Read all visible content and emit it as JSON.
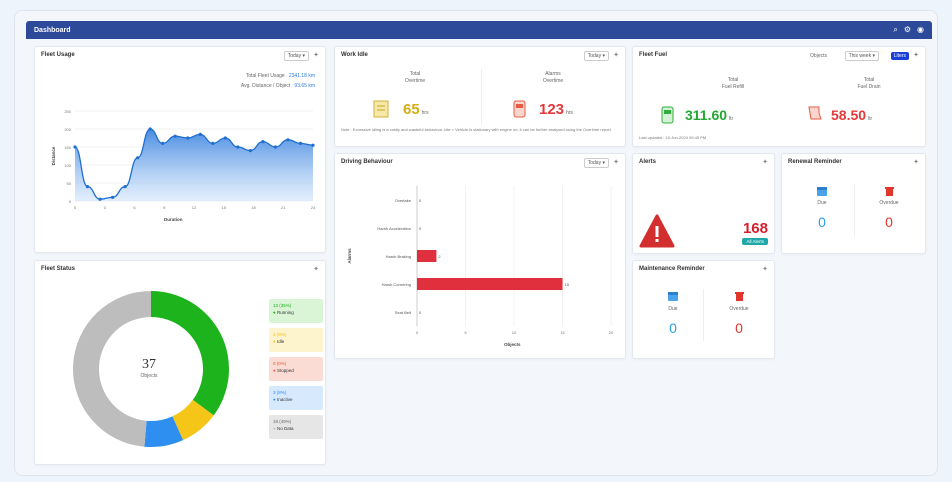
{
  "header": {
    "title": "Dashboard",
    "icons": [
      "search-icon",
      "gear-icon",
      "user-icon"
    ]
  },
  "fleet_usage": {
    "title": "Fleet Usage",
    "period": "Today",
    "total_fleet_usage_label": "Total Fleet Usage",
    "total_fleet_usage_value": "2341.18 km",
    "avg_distance_label": "Avg. Distance / Object",
    "avg_distance_value": "93.65 km",
    "ylabel": "Distance",
    "xlabel": "Duration"
  },
  "chart_data": {
    "type": "area",
    "x": [
      "0",
      "3",
      "6",
      "9",
      "12",
      "15",
      "18",
      "21",
      "24"
    ],
    "yticks": [
      "0",
      "50",
      "100",
      "150",
      "200",
      "250"
    ],
    "ylim": [
      0,
      250
    ],
    "values": [
      150,
      40,
      5,
      10,
      40,
      120,
      200,
      160,
      180,
      175,
      185,
      160,
      175,
      150,
      140,
      165,
      150,
      170,
      160,
      155
    ],
    "xlabel": "Duration",
    "ylabel": "Distance"
  },
  "work_idle": {
    "title": "Work Idle",
    "period": "Today",
    "left_label_1": "Total",
    "left_label_2": "Overtime",
    "left_value": "65",
    "left_unit": "hrs",
    "right_label_1": "Alarms",
    "right_label_2": "Overtime",
    "right_value": "123",
    "right_unit": "hrs",
    "note": "Note : Excessive idling is a costly and wasteful behaviour. Idle = Vehicle is stationary with engine on; it can be further analysed using the Overtime report."
  },
  "fleet_fuel": {
    "title": "Fleet Fuel",
    "filter_1": "Objects",
    "filter_2": "This week",
    "badge": "Liters",
    "left_label_1": "Total",
    "left_label_2": "Fuel Refill",
    "left_value": "311.60",
    "left_unit": "ltr",
    "right_label_1": "Total",
    "right_label_2": "Fuel Drain",
    "right_value": "58.50",
    "right_unit": "ltr",
    "note": "Last updated : 10-Jun-2024 09:45 PM"
  },
  "driving_behaviour": {
    "title": "Driving Behaviour",
    "period": "Today",
    "ylabel": "Alarms",
    "xlabel": "Objects",
    "categories": [
      "Overtake",
      "Harsh Acceleration",
      "Harsh Braking",
      "Harsh Cornering",
      "Seat Belt"
    ],
    "values": [
      0,
      0,
      2,
      15,
      0
    ],
    "xticks": [
      "0",
      "5",
      "10",
      "15",
      "20"
    ],
    "xlim": [
      0,
      20
    ]
  },
  "alerts": {
    "title": "Alerts",
    "value": "168",
    "badge": "All Alerts"
  },
  "renewal_reminder": {
    "title": "Renewal Reminder",
    "due_label": "Due",
    "overdue_label": "Overdue",
    "due_value": "0",
    "overdue_value": "0"
  },
  "maintenance_reminder": {
    "title": "Maintenance Reminder",
    "due_label": "Due",
    "overdue_label": "Overdue",
    "due_value": "0",
    "overdue_value": "0"
  },
  "fleet_status": {
    "title": "Fleet Status",
    "total": "37",
    "total_label": "Objects",
    "segments": [
      {
        "name": "Running",
        "count": "13 (35%)",
        "value": 13,
        "color": "#1db31d",
        "bg": "#d9f5d6"
      },
      {
        "name": "Idle",
        "count": "3 (8%)",
        "value": 3,
        "color": "#f5c518",
        "bg": "#fdf3cd"
      },
      {
        "name": "Stopped",
        "count": "0 (0%)",
        "value": 0,
        "color": "#e8533a",
        "bg": "#fbdcd5"
      },
      {
        "name": "Inactive",
        "count": "3 (8%)",
        "value": 3,
        "color": "#2e8ff0",
        "bg": "#d7e9fc"
      },
      {
        "name": "No Data",
        "count": "18 (49%)",
        "value": 18,
        "color": "#bdbdbd",
        "bg": "#e6e6e6"
      }
    ]
  }
}
